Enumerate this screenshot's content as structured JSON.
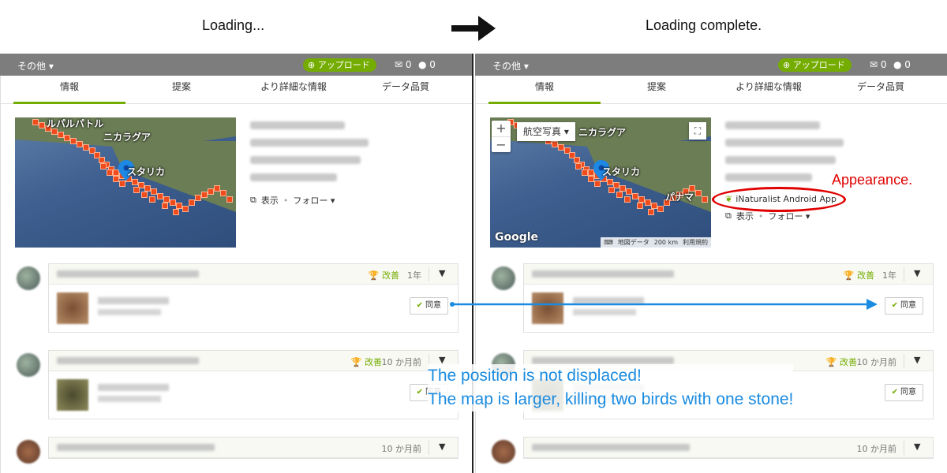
{
  "captions": {
    "left": "Loading...",
    "right": "Loading complete."
  },
  "topnav": {
    "more": "その他 ▾",
    "upload": "アップロード",
    "mail_count": "0",
    "chat_count": "0"
  },
  "tabs": [
    "情報",
    "提案",
    "より詳細な情報",
    "データ品質"
  ],
  "map": {
    "labels": {
      "nicaragua": "ニカラグア",
      "costarica": "スタリカ",
      "panama": "パナマ",
      "guatemala": "ルパルパトル"
    },
    "maptype": "航空写真 ▾",
    "google": "Google",
    "footer": [
      "地図データ",
      "200 km",
      "利用規約"
    ],
    "zoom_in": "+",
    "zoom_out": "−",
    "fullscreen": "⛶"
  },
  "meta": {
    "view": "表示",
    "follow": "フォロー ▾",
    "app": "iNaturalist Android App"
  },
  "identifications": [
    {
      "improve": "改善",
      "age": "1年",
      "agree": "同意"
    },
    {
      "improve": "改善",
      "age": "10 か月前",
      "agree": "同意"
    },
    {
      "improve": "",
      "age": "10 か月前",
      "agree": ""
    }
  ],
  "annotations": {
    "appearance": "Appearance.",
    "line1": "The position is not displaced!",
    "line2": "The map is larger, killing two birds with one stone!"
  },
  "colors": {
    "brand_green": "#74ac00",
    "annotation_red": "#e00000",
    "annotation_blue": "#1a8be0"
  }
}
